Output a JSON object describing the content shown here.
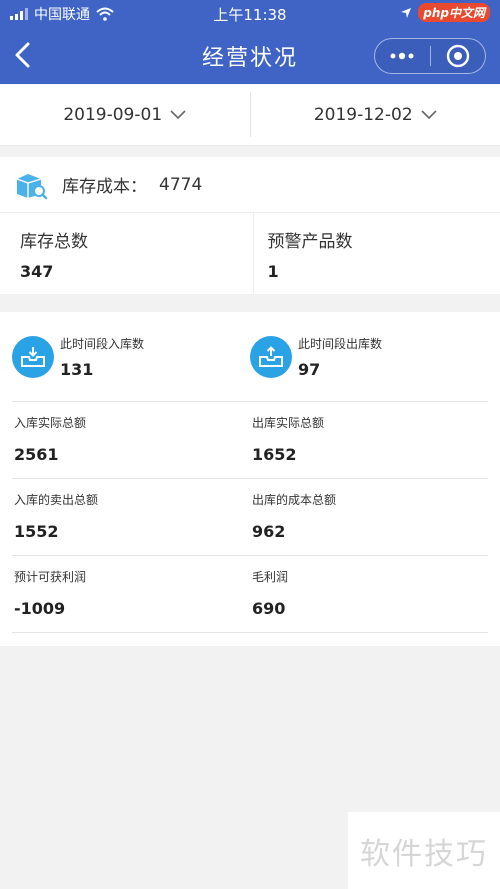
{
  "status_bar": {
    "carrier": "中国联通",
    "time": "上午11:38",
    "badge": "php中文网"
  },
  "nav": {
    "title": "经营状况"
  },
  "dates": {
    "start": "2019-09-01",
    "end": "2019-12-02"
  },
  "inventory": {
    "cost_label": "库存成本：",
    "cost_value": "4774",
    "total_label": "库存总数",
    "total_value": "347",
    "warning_label": "预警产品数",
    "warning_value": "1"
  },
  "flow": {
    "inbound_label": "此时间段入库数",
    "inbound_value": "131",
    "outbound_label": "此时间段出库数",
    "outbound_value": "97",
    "rows": [
      {
        "left_label": "入库实际总额",
        "left_value": "2561",
        "right_label": "出库实际总额",
        "right_value": "1652"
      },
      {
        "left_label": "入库的卖出总额",
        "left_value": "1552",
        "right_label": "出库的成本总额",
        "right_value": "962"
      },
      {
        "left_label": "预计可获利润",
        "left_value": "-1009",
        "right_label": "毛利润",
        "right_value": "690"
      }
    ]
  },
  "watermark": "软件技巧",
  "colors": {
    "header": "#3f64c6",
    "icon_blue": "#29a3e6",
    "background": "#f2f2f2"
  }
}
